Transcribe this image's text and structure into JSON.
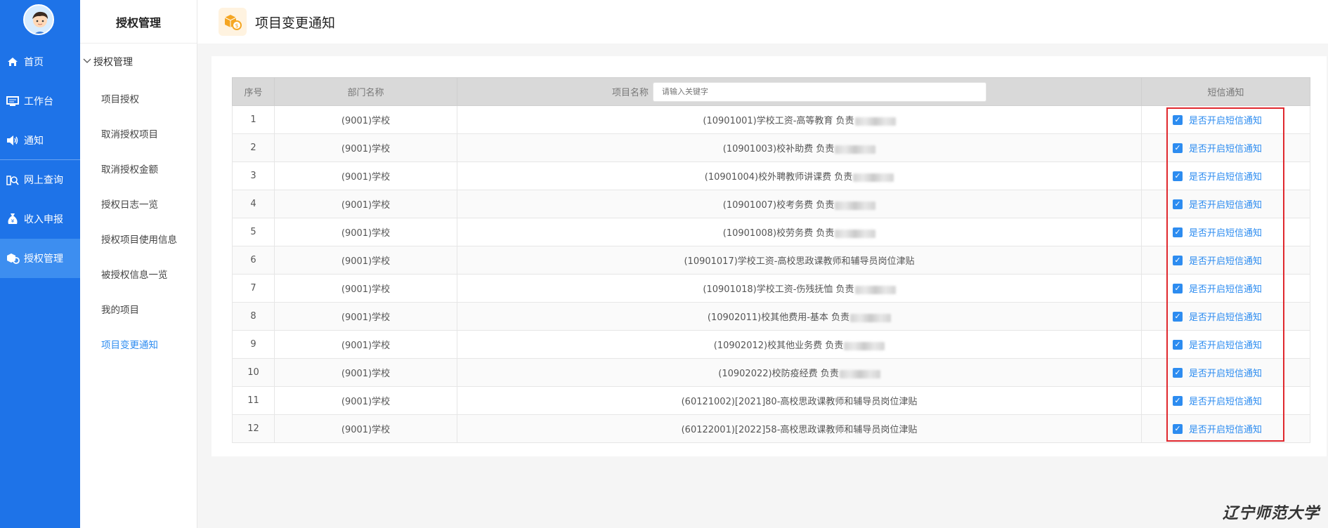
{
  "nav": {
    "items": [
      {
        "label": "首页",
        "icon": "home-icon"
      },
      {
        "label": "工作台",
        "icon": "monitor-icon"
      },
      {
        "label": "通知",
        "icon": "speaker-icon"
      },
      {
        "label": "网上查询",
        "icon": "query-icon"
      },
      {
        "label": "收入申报",
        "icon": "money-bag-icon"
      },
      {
        "label": "授权管理",
        "icon": "cubes-icon"
      }
    ]
  },
  "submenu": {
    "title": "授权管理",
    "group": "授权管理",
    "items": [
      "项目授权",
      "取消授权项目",
      "取消授权金额",
      "授权日志一览",
      "授权项目使用信息",
      "被授权信息一览",
      "我的项目",
      "项目变更通知"
    ]
  },
  "header": {
    "title": "项目变更通知"
  },
  "table": {
    "headers": {
      "index": "序号",
      "dept": "部门名称",
      "project": "项目名称",
      "sms": "短信通知"
    },
    "search_placeholder": "请输入关键字",
    "checkbox_label": "是否开启短信通知",
    "rows": [
      {
        "index": "1",
        "dept": "(9001)学校",
        "project": "(10901001)学校工资-高等教育 负责"
      },
      {
        "index": "2",
        "dept": "(9001)学校",
        "project": "(10901003)校补助费 负责"
      },
      {
        "index": "3",
        "dept": "(9001)学校",
        "project": "(10901004)校外聘教师讲课费 负责"
      },
      {
        "index": "4",
        "dept": "(9001)学校",
        "project": "(10901007)校考务费 负责"
      },
      {
        "index": "5",
        "dept": "(9001)学校",
        "project": "(10901008)校劳务费 负责"
      },
      {
        "index": "6",
        "dept": "(9001)学校",
        "project": "(10901017)学校工资-高校思政课教师和辅导员岗位津贴"
      },
      {
        "index": "7",
        "dept": "(9001)学校",
        "project": "(10901018)学校工资-伤残抚恤 负责"
      },
      {
        "index": "8",
        "dept": "(9001)学校",
        "project": "(10902011)校其他费用-基本 负责"
      },
      {
        "index": "9",
        "dept": "(9001)学校",
        "project": "(10902012)校其他业务费 负责"
      },
      {
        "index": "10",
        "dept": "(9001)学校",
        "project": "(10902022)校防疫经费 负责"
      },
      {
        "index": "11",
        "dept": "(9001)学校",
        "project": "(60121002)[2021]80-高校思政课教师和辅导员岗位津贴"
      },
      {
        "index": "12",
        "dept": "(9001)学校",
        "project": "(60122001)[2022]58-高校思政课教师和辅导员岗位津贴"
      }
    ]
  },
  "watermark": "辽宁师范大学",
  "colors": {
    "nav_bg": "#1e73e8",
    "accent": "#2d8cf0",
    "highlight_box": "#e0282e"
  }
}
